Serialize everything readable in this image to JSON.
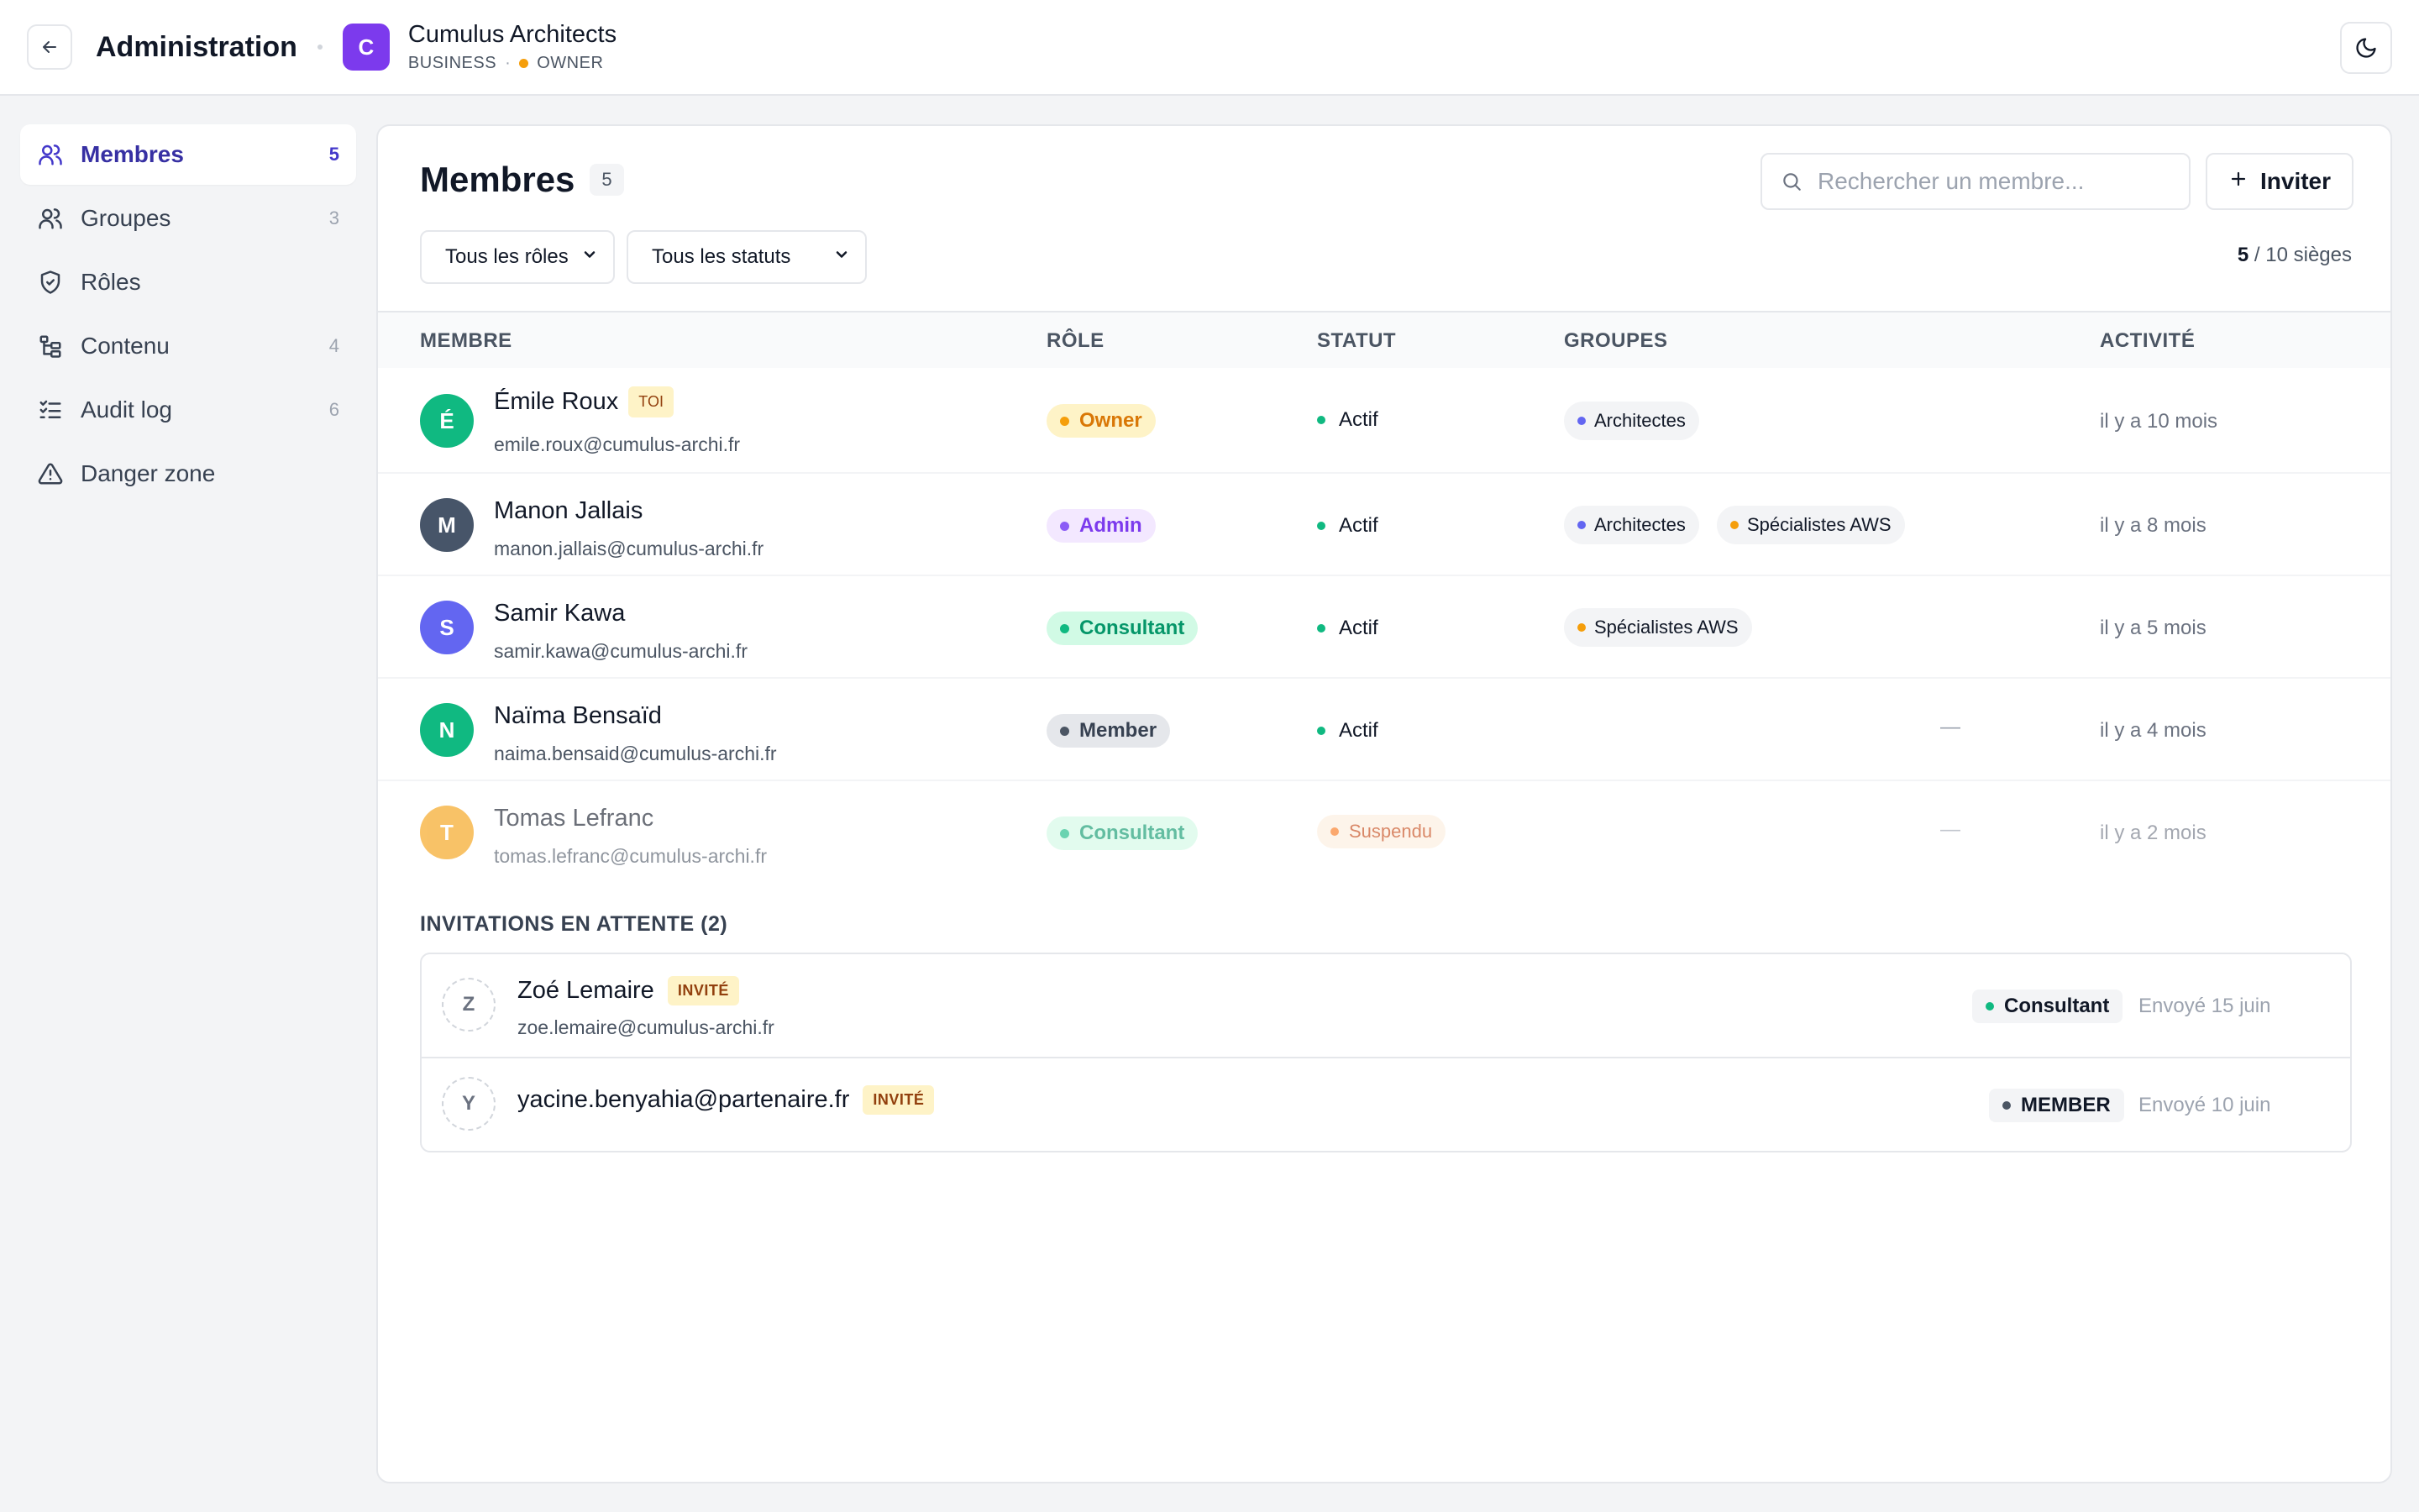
{
  "header": {
    "title": "Administration",
    "org": {
      "initial": "C",
      "name": "Cumulus Architects",
      "plan": "BUSINESS",
      "separator": "·",
      "role": "OWNER",
      "accent": "#7c3aed"
    }
  },
  "sidebar": {
    "items": [
      {
        "label": "Membres",
        "count": "5",
        "icon": "users-icon",
        "active": true
      },
      {
        "label": "Groupes",
        "count": "3",
        "icon": "group-icon"
      },
      {
        "label": "Rôles",
        "count": "",
        "icon": "shield-icon"
      },
      {
        "label": "Contenu",
        "count": "4",
        "icon": "tree-icon"
      },
      {
        "label": "Audit log",
        "count": "6",
        "icon": "checklist-icon"
      },
      {
        "label": "Danger zone",
        "count": "",
        "icon": "warning-icon"
      }
    ]
  },
  "main": {
    "title": "Membres",
    "count": "5",
    "search_placeholder": "Rechercher un membre...",
    "invite_label": "Inviter",
    "filters": {
      "role": "Tous les rôles",
      "status": "Tous les statuts"
    },
    "seats": {
      "used": "5",
      "rest": " / 10 sièges"
    },
    "columns": {
      "member": "MEMBRE",
      "role": "RÔLE",
      "status": "STATUT",
      "groups": "GROUPES",
      "activity": "ACTIVITÉ"
    },
    "members": [
      {
        "initial": "É",
        "avatar_color": "#10b981",
        "name": "Émile Roux",
        "you_badge": "TOI",
        "email": "emile.roux@cumulus-archi.fr",
        "role": "Owner",
        "role_fg": "#d97706",
        "role_bg": "#fef3c7",
        "role_dot": "#f59e0b",
        "status": "Actif",
        "groups": [
          {
            "name": "Architectes",
            "dot": "#6366f1"
          }
        ],
        "activity": "il y a 10 mois"
      },
      {
        "initial": "M",
        "avatar_color": "#475569",
        "name": "Manon Jallais",
        "email": "manon.jallais@cumulus-archi.fr",
        "role": "Admin",
        "role_fg": "#7c3aed",
        "role_bg": "#f3e8ff",
        "role_dot": "#8b5cf6",
        "status": "Actif",
        "groups": [
          {
            "name": "Architectes",
            "dot": "#6366f1"
          },
          {
            "name": "Spécialistes AWS",
            "dot": "#f59e0b"
          }
        ],
        "activity": "il y a 8 mois"
      },
      {
        "initial": "S",
        "avatar_color": "#6366f1",
        "name": "Samir Kawa",
        "email": "samir.kawa@cumulus-archi.fr",
        "role": "Consultant",
        "role_fg": "#059669",
        "role_bg": "#d1fae5",
        "role_dot": "#10b981",
        "status": "Actif",
        "groups": [
          {
            "name": "Spécialistes AWS",
            "dot": "#f59e0b"
          }
        ],
        "activity": "il y a 5 mois"
      },
      {
        "initial": "N",
        "avatar_color": "#10b981",
        "name": "Naïma Bensaïd",
        "email": "naima.bensaid@cumulus-archi.fr",
        "role": "Member",
        "role_fg": "#374151",
        "role_bg": "#e5e7eb",
        "role_dot": "#4b5563",
        "status": "Actif",
        "groups_empty": "—",
        "activity": "il y a 4 mois"
      },
      {
        "initial": "T",
        "avatar_color": "#f59e0b",
        "name": "Tomas Lefranc",
        "email": "tomas.lefranc@cumulus-archi.fr",
        "role": "Consultant",
        "role_fg": "#059669",
        "role_bg": "#d1fae5",
        "role_dot": "#10b981",
        "status": "Suspendu",
        "groups_empty": "—",
        "activity": "il y a 2 mois"
      }
    ],
    "invitations": {
      "title": "INVITATIONS EN ATTENTE (2)",
      "items": [
        {
          "initial": "Z",
          "name": "Zoé Lemaire",
          "badge": "INVITÉ",
          "email": "zoe.lemaire@cumulus-archi.fr",
          "role": "Consultant",
          "role_dot": "#10b981",
          "sent": "Envoyé 15 juin"
        },
        {
          "initial": "Y",
          "name": "yacine.benyahia@partenaire.fr",
          "badge": "INVITÉ",
          "email": "",
          "role": "MEMBER",
          "role_dot": "#4b5563",
          "sent": "Envoyé 10 juin"
        }
      ]
    }
  }
}
